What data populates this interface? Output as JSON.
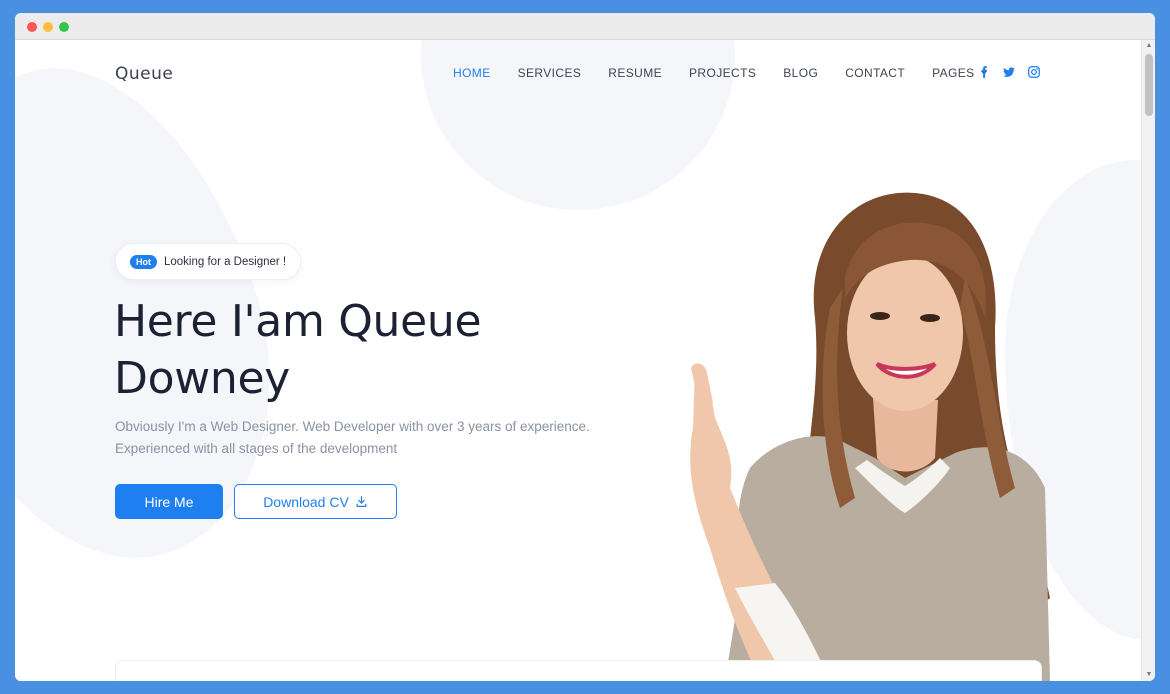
{
  "site": {
    "logo": "Queue"
  },
  "nav": {
    "items": [
      {
        "label": "HOME",
        "active": true
      },
      {
        "label": "SERVICES",
        "active": false
      },
      {
        "label": "RESUME",
        "active": false
      },
      {
        "label": "PROJECTS",
        "active": false
      },
      {
        "label": "BLOG",
        "active": false
      },
      {
        "label": "CONTACT",
        "active": false
      },
      {
        "label": "PAGES",
        "active": false,
        "has_dropdown": true
      }
    ],
    "social_icons": [
      "facebook-icon",
      "twitter-icon",
      "instagram-icon"
    ]
  },
  "hero": {
    "badge_tag": "Hot",
    "badge_text": "Looking for a Designer !",
    "headline_line1": "Here I'am Queue",
    "headline_line2": "Downey",
    "subtitle_line1": "Obviously I'm a Web Designer. Web Developer with over 3 years of experience.",
    "subtitle_line2": "Experienced with all stages of the development",
    "hire_label": "Hire Me",
    "cv_label": "Download CV"
  },
  "colors": {
    "accent": "#1e7ff0",
    "heading": "#1c2233",
    "muted": "#8a92a3",
    "blob": "#f4f6fa",
    "frame": "#4a90e2"
  }
}
